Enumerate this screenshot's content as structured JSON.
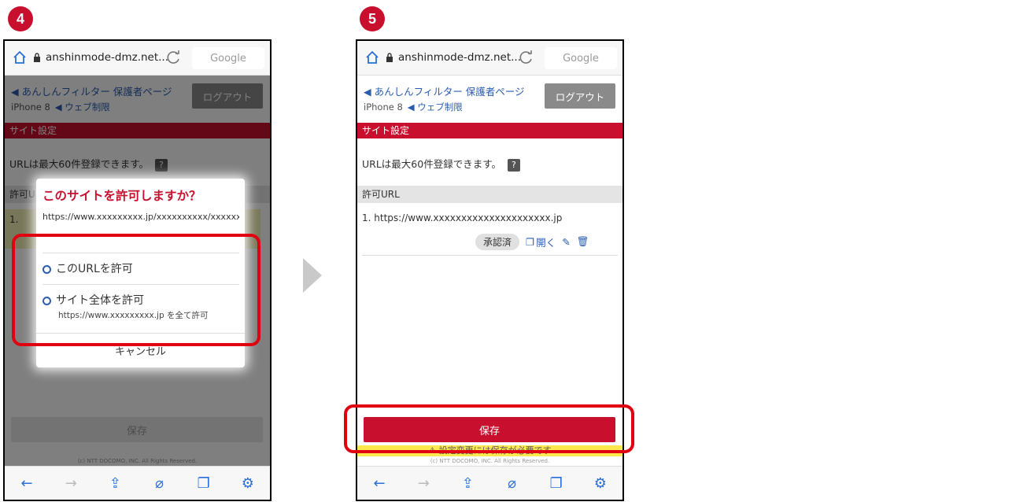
{
  "steps": {
    "left": "4",
    "right": "5"
  },
  "browser": {
    "url": "anshinmode-dmz.net...",
    "search_label": "Google"
  },
  "page": {
    "back_link": "◀ あんしんフィルター 保護者ページ",
    "device": "iPhone 8",
    "web_link": "◀ ウェブ制限",
    "logout_label": "ログアウト",
    "section_title": "サイト設定",
    "url_note": "URLは最大60件登録できます。",
    "help_icon": "?",
    "list_header": "許可URL",
    "entry_url": "1. https://www.xxxxxxxxxxxxxxxxxxxxx.jp",
    "entry_url_cut": "1.",
    "approved_badge": "承認済",
    "open_label": "開く",
    "save_label": "保存",
    "warning": "⚠ 設定変更には保存が必要です",
    "copyright": "(c) NTT DOCOMO, INC. All Rights Reserved."
  },
  "dialog": {
    "title": "このサイトを許可しますか？",
    "url": "https://www.xxxxxxxxx.jp/xxxxxxxxxx/xxxxxxxxxx.html",
    "option_url": "このURLを許可",
    "option_site": "サイト全体を許可",
    "option_site_sub": "https://www.xxxxxxxxx.jp を全て許可",
    "cancel": "キャンセル"
  },
  "toolbar_icons": [
    "back-arrow-icon",
    "forward-arrow-icon",
    "share-icon",
    "tag-icon",
    "tabs-icon",
    "settings-icon"
  ],
  "colors": {
    "accent_red": "#c8102e",
    "link_blue": "#2a5db0",
    "highlight_red": "#e0000f",
    "warning_yellow": "#fce94f"
  }
}
